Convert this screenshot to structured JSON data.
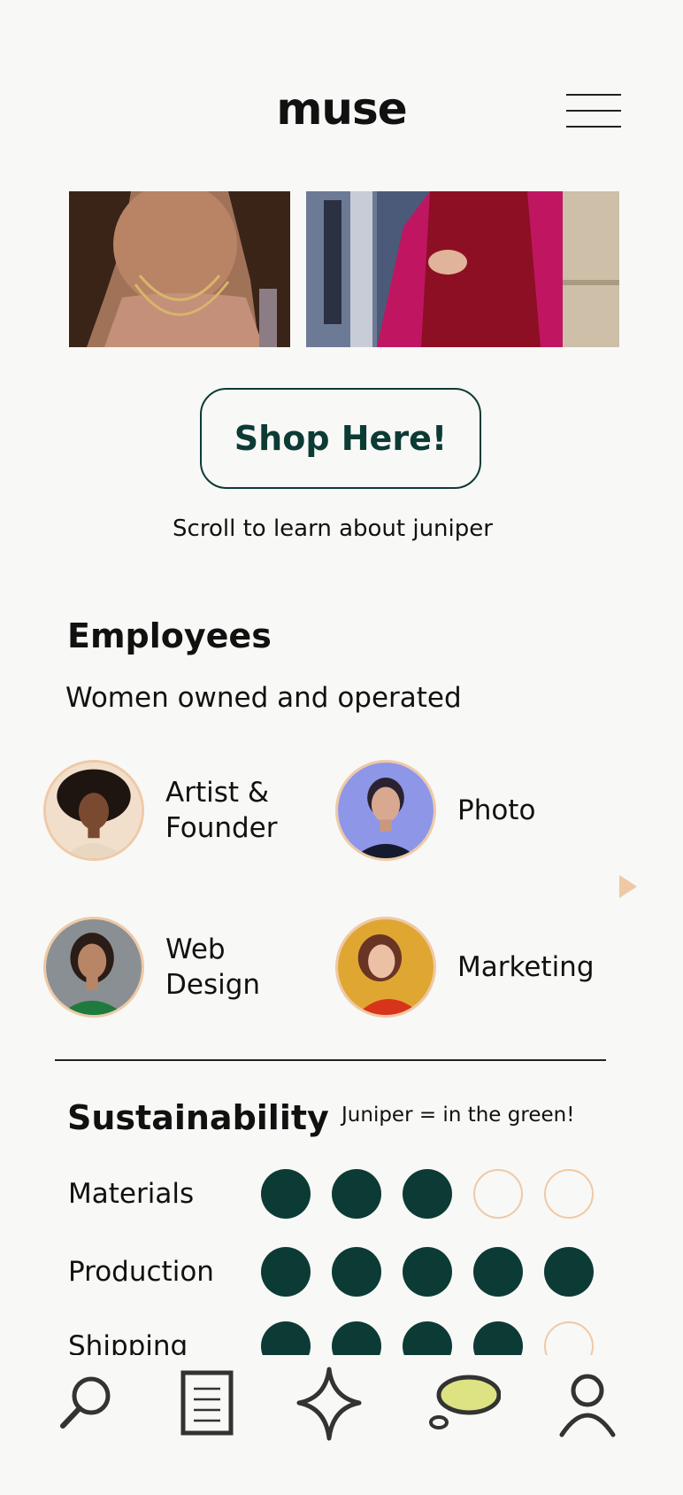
{
  "app": {
    "logo": "muse"
  },
  "hero": {
    "cta_label": "Shop Here!",
    "scroll_hint": "Scroll to learn about juniper"
  },
  "employees": {
    "title": "Employees",
    "subtitle": "Women owned and operated",
    "members": [
      {
        "role": "Artist &\nFounder"
      },
      {
        "role": "Photo"
      },
      {
        "role": "Web\nDesign"
      },
      {
        "role": "Marketing"
      }
    ]
  },
  "sustainability": {
    "title": "Sustainability",
    "tagline": "Juniper = in the green!",
    "ratings": [
      {
        "label": "Materials",
        "score": 3,
        "max": 5
      },
      {
        "label": "Production",
        "score": 5,
        "max": 5
      },
      {
        "label": "Shipping",
        "score": 4,
        "max": 5
      }
    ]
  },
  "tabbar": {
    "items": [
      {
        "icon": "search-icon"
      },
      {
        "icon": "document-icon"
      },
      {
        "icon": "sparkle-icon"
      },
      {
        "icon": "chat-bubble-icon"
      },
      {
        "icon": "profile-icon"
      }
    ]
  },
  "colors": {
    "primary": "#0c3b35",
    "accent": "#efc9a6",
    "background": "#f8f8f6",
    "chat_fill": "#dde283"
  }
}
